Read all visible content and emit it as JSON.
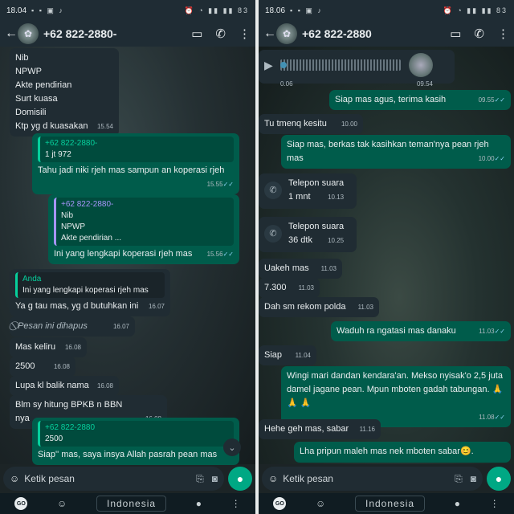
{
  "left": {
    "status": {
      "time": "18.04",
      "battery": "83"
    },
    "contact": "+62 822-2880-",
    "messages": {
      "m1": {
        "lines": [
          "Nib",
          "NPWP",
          "Akte pendirian",
          "Surt kuasa",
          "Domisili",
          "Ktp yg d kuasakan"
        ],
        "time": "15.54"
      },
      "m2": {
        "quote_name": "+62 822-2880-",
        "quote_text": "1 jt 972",
        "text": "Tahu jadi niki rjeh mas sampun an koperasi rjeh",
        "time": "15.55"
      },
      "m3": {
        "quote_name": "+62 822-2880-",
        "quote_lines": [
          "Nib",
          "NPWP",
          "Akte pendirian ..."
        ],
        "text": "Ini yang lengkapi koperasi rjeh mas",
        "time": "15.56"
      },
      "m4": {
        "quote_name": "Anda",
        "quote_text": "Ini yang lengkapi koperasi rjeh mas",
        "text": "Ya g tau mas, yg d butuhkan ini",
        "time": "16.07"
      },
      "m5": {
        "text": "Pesan ini dihapus",
        "time": "16.07"
      },
      "m6": {
        "text": "Mas keliru",
        "time": "16.08"
      },
      "m7": {
        "text": "2500",
        "time": "16.08"
      },
      "m8": {
        "text": "Lupa kl balik nama",
        "time": "16.08"
      },
      "m9": {
        "text": "Blm sy hitung BPKB n BBN nya",
        "time": "16.08"
      },
      "m10": {
        "quote_name": "+62 822-2880",
        "quote_text": "2500",
        "text": "Siap'' mas, saya insya Allah pasrah pean mas"
      }
    },
    "composer": {
      "placeholder": "Ketik pesan"
    },
    "keyboard": {
      "language": "Indonesia"
    }
  },
  "right": {
    "status": {
      "time": "18.06",
      "battery": "83"
    },
    "contact": "+62 822-2880",
    "voice": {
      "elapsed": "0.06",
      "time": "09.54"
    },
    "messages": {
      "r1": {
        "text": "Siap mas agus, terima kasih",
        "time": "09.55"
      },
      "r2": {
        "text": "Tu tmenq kesitu",
        "time": "10.00"
      },
      "r3": {
        "text": "Siap mas, berkas tak kasihkan teman'nya pean rjeh mas",
        "time": "10.00"
      },
      "r4": {
        "title": "Telepon suara",
        "sub": "1 mnt",
        "time": "10.13"
      },
      "r5": {
        "title": "Telepon suara",
        "sub": "36 dtk",
        "time": "10.25"
      },
      "r6": {
        "text": "Uakeh mas",
        "time": "11.03"
      },
      "r7": {
        "text": "7.300",
        "time": "11.03"
      },
      "r8": {
        "text": "Dah sm rekom polda",
        "time": "11.03"
      },
      "r9": {
        "text": "Waduh ra ngatasi mas danaku",
        "time": "11.03"
      },
      "r10": {
        "text": "Siap",
        "time": "11.04"
      },
      "r11": {
        "text": "Wingi mari dandan kendara'an. Mekso nyisak'o 2,5 juta damel jagane pean. Mpun mboten gadah tabungan.",
        "time": "11.08"
      },
      "r12": {
        "text": "Hehe geh mas, sabar",
        "time": "11.16"
      },
      "r13": {
        "text": "Lha pripun maleh mas nek mboten sabar"
      }
    },
    "composer": {
      "placeholder": "Ketik pesan"
    },
    "keyboard": {
      "language": "Indonesia"
    }
  },
  "colors": {
    "incoming": "#202c33",
    "outgoing": "#005c4b",
    "accent": "#00a884",
    "header": "#1f2c34"
  }
}
